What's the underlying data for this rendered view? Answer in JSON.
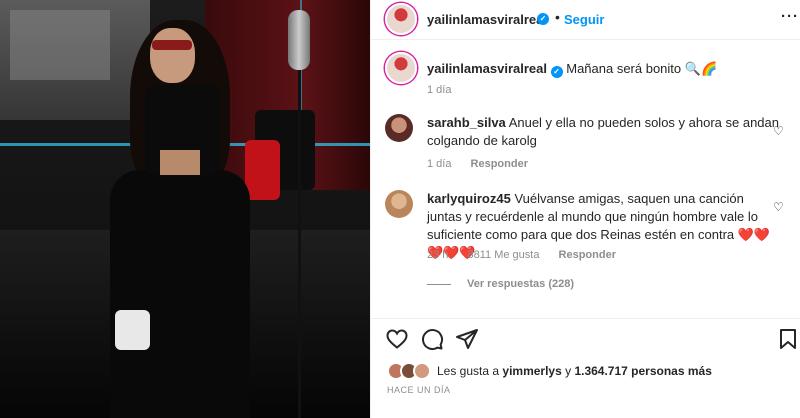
{
  "header": {
    "username": "yailinlamasviralreal",
    "separator": "•",
    "follow_label": "Seguir",
    "more_label": "···"
  },
  "caption": {
    "username": "yailinlamasviralreal",
    "text": "Mañana será bonito 🔍🌈",
    "time": "1 día"
  },
  "comments": [
    {
      "username": "sarahb_silva",
      "text": "Anuel y ella no pueden solos y ahora se andan colgando de karolg",
      "time": "1 día",
      "likes": "",
      "reply_label": "Responder"
    },
    {
      "username": "karlyquiroz45",
      "text": "Vuélvanse amigas, saquen una canción juntas y recuérdenle al mundo que ningún hombre vale lo suficiente como para que dos Reinas estén en contra ❤️❤️❤️❤️❤️",
      "time": "23 h",
      "likes": "8811 Me gusta",
      "reply_label": "Responder"
    }
  ],
  "view_replies": "Ver respuestas (228)",
  "likes_summary": {
    "prefix": "Les gusta a ",
    "user": "yimmerlys",
    "middle": " y ",
    "count": "1.364.717 personas más"
  },
  "timestamp": "HACE UN DÍA",
  "icons": {
    "heart": "heart-icon",
    "comment": "comment-icon",
    "share": "share-icon",
    "save": "bookmark-icon"
  },
  "colors": {
    "accent": "#0095f6",
    "muted": "#8e8e8e",
    "text": "#262626"
  }
}
